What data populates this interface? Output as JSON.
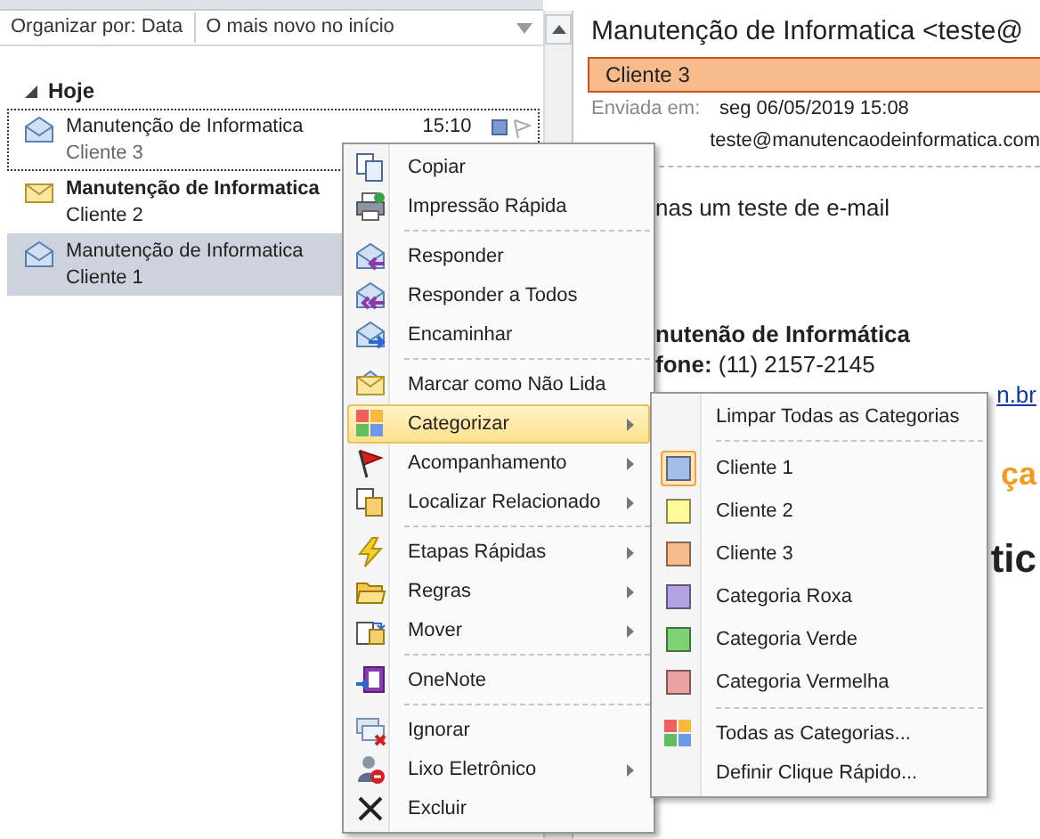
{
  "list_header": {
    "sort_by": "Organizar por: Data",
    "order": "O mais novo no início"
  },
  "group": {
    "label": "Hoje",
    "expanded": true
  },
  "messages": [
    {
      "sender": "Manutenção de Informatica",
      "subject": "Cliente 3",
      "time": "15:10",
      "unread": false,
      "selected": false,
      "focused": true
    },
    {
      "sender": "Manutenção de Informatica",
      "subject": "Cliente 2",
      "unread": true,
      "selected": false,
      "focused": false
    },
    {
      "sender": "Manutenção de Informatica",
      "subject": "Cliente 1",
      "unread": false,
      "selected": true,
      "focused": false
    }
  ],
  "reading_pane": {
    "title": "Manutenção de Informatica <teste@",
    "category": {
      "label": "Cliente 3",
      "color": "#f8bb8c"
    },
    "sent_label": "Enviada em:",
    "sent_value": "seg 06/05/2019 15:08",
    "to_value": "teste@manutencaodeinformatica.com",
    "body": [
      {
        "kind": "text",
        "text": "nas um teste de e-mail"
      },
      {
        "kind": "bold",
        "text": "nutenão de Informática"
      },
      {
        "kind": "text",
        "text": "**fone:** (11) 2157-2145"
      },
      {
        "kind": "link",
        "text": "n.br"
      },
      {
        "kind": "orange_heading",
        "text": "ça"
      },
      {
        "kind": "heading",
        "text": "tic"
      }
    ]
  },
  "context_menu": {
    "items": [
      {
        "kind": "item",
        "label": "Copiar",
        "submenu": false,
        "highlighted": false
      },
      {
        "kind": "item",
        "label": "Impressão Rápida",
        "submenu": false,
        "highlighted": false
      },
      {
        "kind": "separator"
      },
      {
        "kind": "item",
        "label": "Responder",
        "submenu": false,
        "highlighted": false
      },
      {
        "kind": "item",
        "label": "Responder a Todos",
        "submenu": false,
        "highlighted": false
      },
      {
        "kind": "item",
        "label": "Encaminhar",
        "submenu": false,
        "highlighted": false
      },
      {
        "kind": "separator"
      },
      {
        "kind": "item",
        "label": "Marcar como Não Lida",
        "submenu": false,
        "highlighted": false
      },
      {
        "kind": "item",
        "label": "Categorizar",
        "submenu": true,
        "highlighted": true
      },
      {
        "kind": "item",
        "label": "Acompanhamento",
        "submenu": true,
        "highlighted": false
      },
      {
        "kind": "item",
        "label": "Localizar Relacionado",
        "submenu": true,
        "highlighted": false
      },
      {
        "kind": "separator"
      },
      {
        "kind": "item",
        "label": "Etapas Rápidas",
        "submenu": true,
        "highlighted": false
      },
      {
        "kind": "item",
        "label": "Regras",
        "submenu": true,
        "highlighted": false
      },
      {
        "kind": "item",
        "label": "Mover",
        "submenu": true,
        "highlighted": false
      },
      {
        "kind": "separator"
      },
      {
        "kind": "item",
        "label": "OneNote",
        "submenu": false,
        "highlighted": false
      },
      {
        "kind": "separator"
      },
      {
        "kind": "item",
        "label": "Ignorar",
        "submenu": false,
        "highlighted": false
      },
      {
        "kind": "item",
        "label": "Lixo Eletrônico",
        "submenu": true,
        "highlighted": false
      },
      {
        "kind": "item",
        "label": "Excluir",
        "submenu": false,
        "highlighted": false
      }
    ]
  },
  "submenu": {
    "items": [
      {
        "kind": "action",
        "label": "Limpar Todas as Categorias"
      },
      {
        "kind": "separator"
      },
      {
        "kind": "category",
        "label": "Cliente 1",
        "color": "#a3bce8",
        "checked": true
      },
      {
        "kind": "category",
        "label": "Cliente 2",
        "color": "#fff99a",
        "checked": false
      },
      {
        "kind": "category",
        "label": "Cliente 3",
        "color": "#f8bb8c",
        "checked": false
      },
      {
        "kind": "category",
        "label": "Categoria Roxa",
        "color": "#b5a2e2",
        "checked": false
      },
      {
        "kind": "category",
        "label": "Categoria Verde",
        "color": "#7dd275",
        "checked": false
      },
      {
        "kind": "category",
        "label": "Categoria Vermelha",
        "color": "#e8a2a2",
        "checked": false
      },
      {
        "kind": "separator"
      },
      {
        "kind": "action",
        "label": "Todas as Categorias..."
      },
      {
        "kind": "action",
        "label": "Definir Clique Rápido..."
      }
    ]
  }
}
